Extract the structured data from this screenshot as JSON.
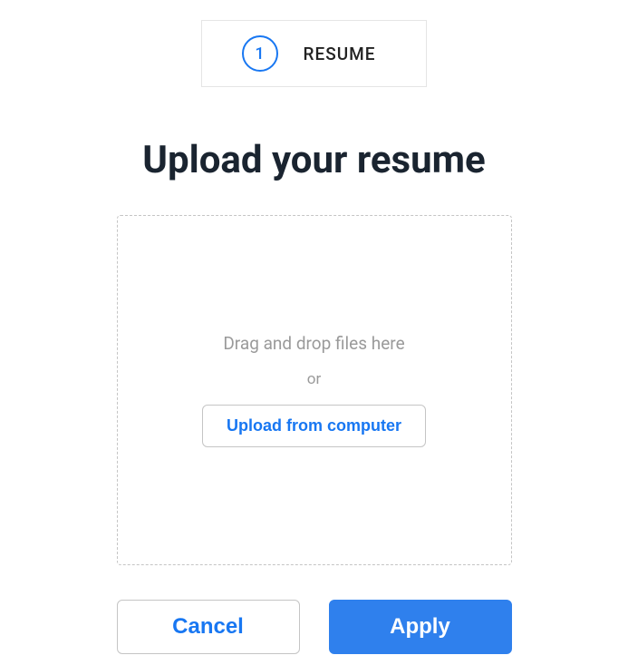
{
  "step": {
    "number": "1",
    "label": "RESUME"
  },
  "title": "Upload your resume",
  "dropzone": {
    "drag_text": "Drag and drop files here",
    "or_text": "or",
    "upload_button": "Upload from computer"
  },
  "actions": {
    "cancel": "Cancel",
    "apply": "Apply"
  }
}
